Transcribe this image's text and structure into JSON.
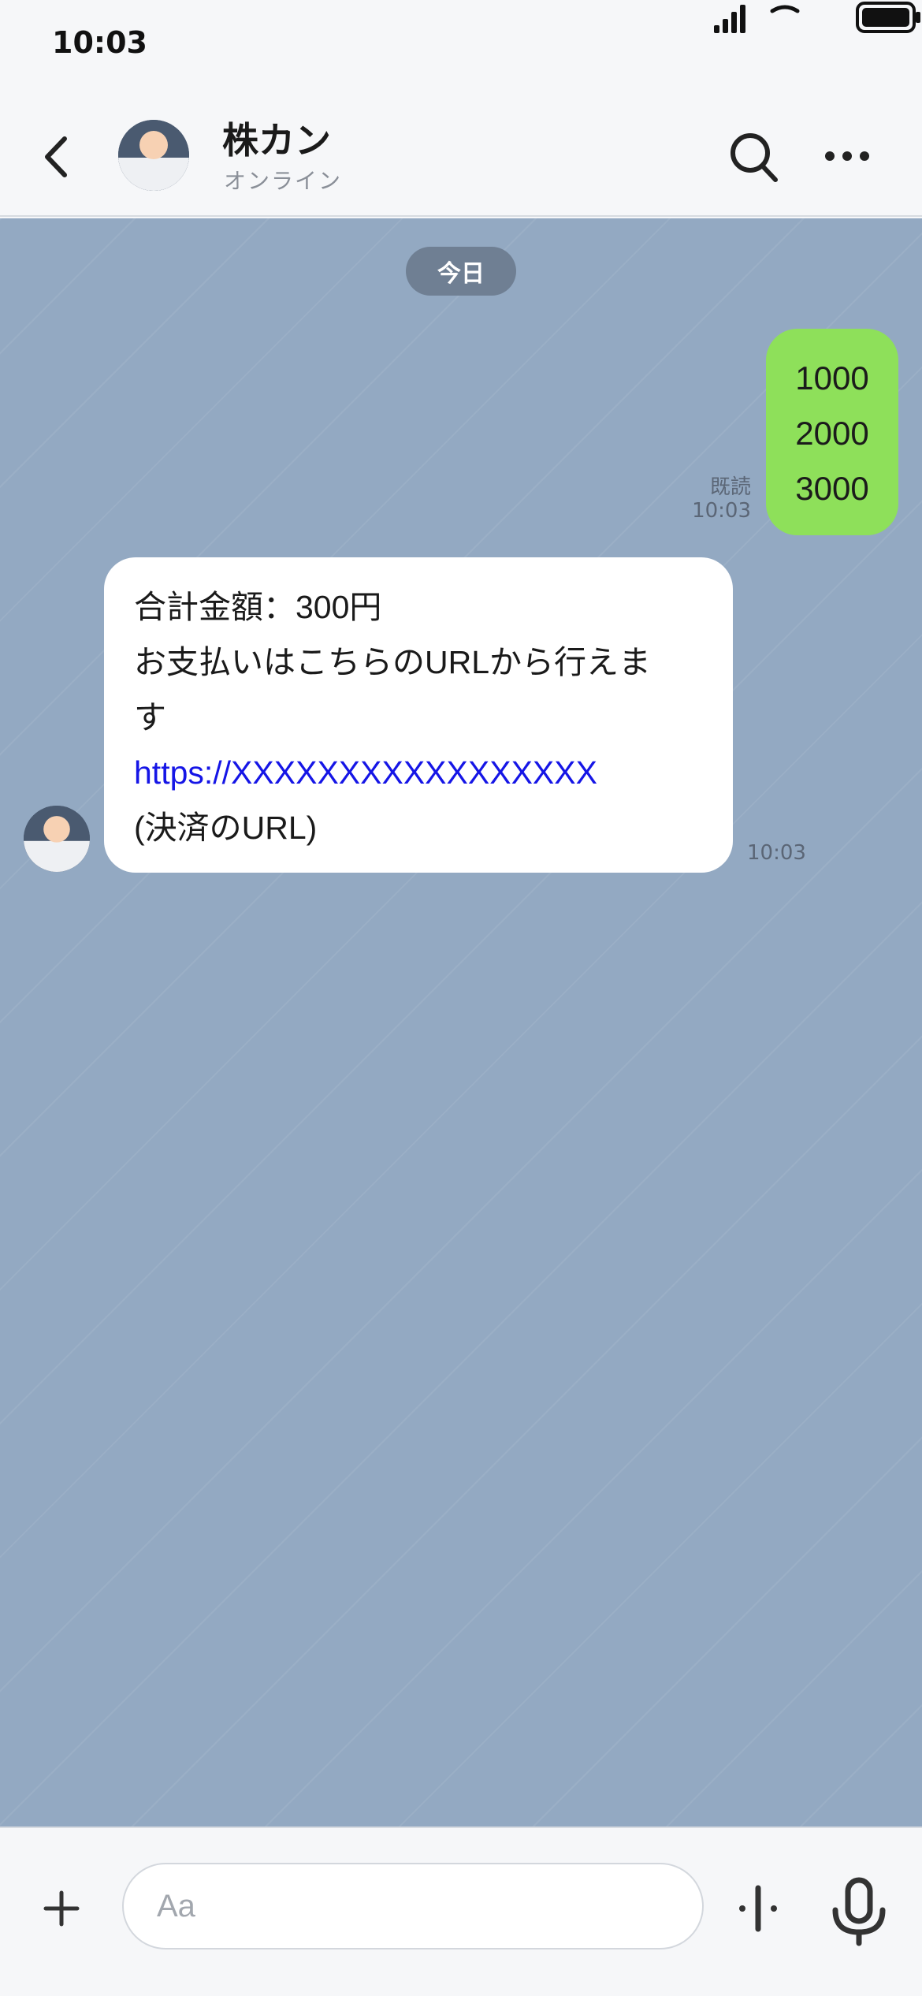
{
  "status_bar": {
    "time": "10:03"
  },
  "header": {
    "contact_name": "株カン",
    "contact_status": "オンライン"
  },
  "chat": {
    "date_label": "今日",
    "outgoing": {
      "lines": [
        "1000",
        "2000",
        "3000"
      ],
      "read_label": "既読",
      "time": "10:03"
    },
    "incoming": {
      "line1": "合計金額：300円",
      "line2": "お支払いはこちらのURLから行えま",
      "line3": "す",
      "link": "https://XXXXXXXXXXXXXXXXX",
      "note": "(決済のURL)",
      "time": "10:03"
    }
  },
  "input_bar": {
    "placeholder": "Aa"
  },
  "colors": {
    "chat_background": "#93a9c2",
    "outgoing_bubble": "#8ee05a",
    "incoming_bubble": "#ffffff",
    "link": "#1515e6",
    "date_pill": "#6f7f93"
  }
}
